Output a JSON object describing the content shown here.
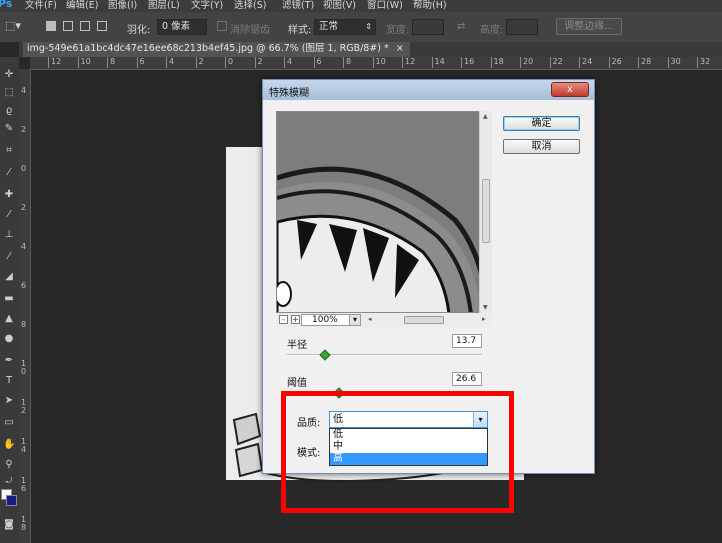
{
  "menubar": {
    "logo": "Ps",
    "items": [
      "文件(F)",
      "编辑(E)",
      "图像(I)",
      "图层(L)",
      "文字(Y)",
      "选择(S)",
      "滤镜(T)",
      "视图(V)",
      "窗口(W)",
      "帮助(H)"
    ]
  },
  "options": {
    "feather_label": "羽化:",
    "feather_value": "0 像素",
    "antialias_label": "消除锯齿",
    "style_label": "样式:",
    "style_value": "正常",
    "width_label": "宽度:",
    "height_label": "高度:",
    "refine_edge_label": "调整边缘..."
  },
  "document": {
    "tab_title": "img-549e61a1bc4dc47e16ee68c213b4ef45.jpg @ 66.7% (图层 1, RGB/8#) *",
    "close_glyph": "×"
  },
  "ruler_top": [
    "12",
    "10",
    "8",
    "6",
    "4",
    "2",
    "0",
    "2",
    "4",
    "6",
    "8",
    "10",
    "12",
    "14",
    "16",
    "18",
    "20",
    "22",
    "24",
    "26",
    "28",
    "30",
    "32"
  ],
  "ruler_left": [
    "4",
    "2",
    "0",
    "2",
    "4",
    "6",
    "8",
    "1 0",
    "1 2",
    "1 4",
    "1 6",
    "1 8"
  ],
  "dialog": {
    "title": "特殊模糊",
    "close_glyph": "x",
    "ok_label": "确定",
    "cancel_label": "取消",
    "zoom_minus": "-",
    "zoom_plus": "+",
    "zoom_value": "100%",
    "zoom_arrow": "▾",
    "radius_label": "半径",
    "radius_value": "13.7",
    "radius_fraction": 0.19,
    "threshold_label": "阈值",
    "threshold_value": "26.6",
    "quality_label": "品质:",
    "quality_value": "低",
    "mode_label": "模式:",
    "quality_options": [
      "低",
      "中",
      "高"
    ],
    "quality_highlighted": "高",
    "dropdown_arrow": "▾"
  },
  "annotation": {
    "highlight_color": "#ff0000"
  }
}
